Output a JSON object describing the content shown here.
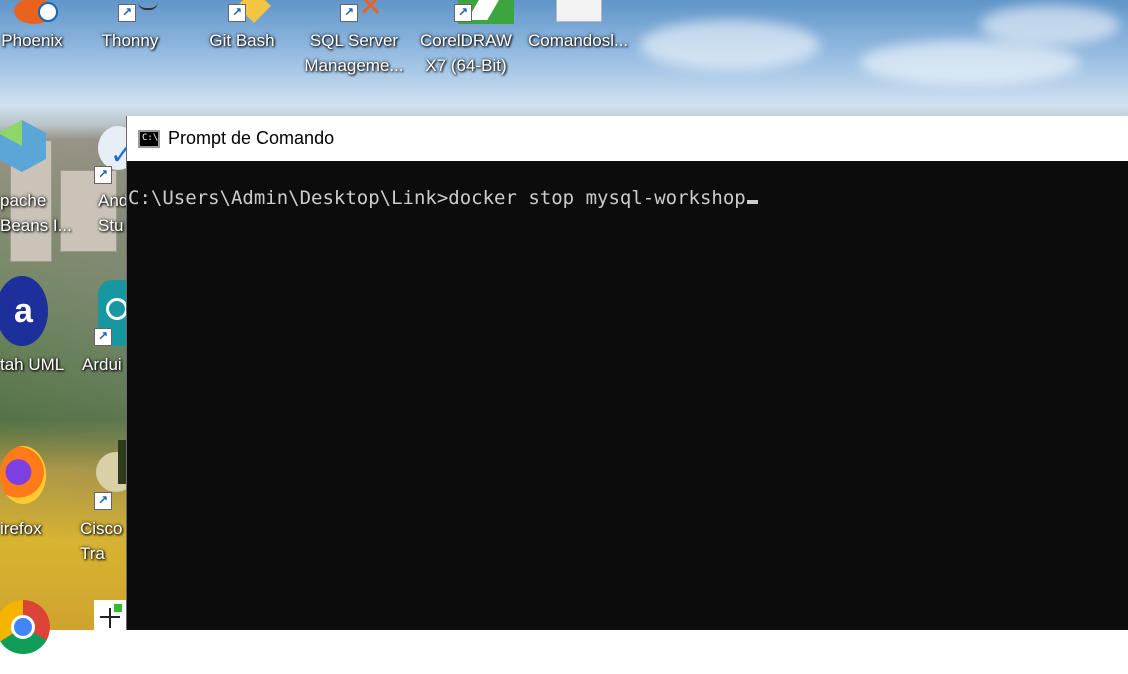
{
  "desktop": {
    "icons": [
      {
        "label": "Phoenix",
        "icon": "phoenix-icon"
      },
      {
        "label": "Thonny",
        "icon": "thonny-icon"
      },
      {
        "label": "Git Bash",
        "icon": "git-bash-icon"
      },
      {
        "label": "SQL Server\nManageme...",
        "icon": "sql-server-icon"
      },
      {
        "label": "CorelDRAW\nX7 (64-Bit)",
        "icon": "coreldraw-icon"
      },
      {
        "label": "Comandosl...",
        "icon": "text-file-icon"
      },
      {
        "label": "pache\nBeans I...",
        "icon": "netbeans-icon"
      },
      {
        "label": "And\nStu",
        "icon": "android-studio-icon"
      },
      {
        "label": "tah UML",
        "icon": "astah-icon"
      },
      {
        "label": "Ardui",
        "icon": "arduino-icon"
      },
      {
        "label": "irefox",
        "icon": "firefox-icon"
      },
      {
        "label": "Cisco\nTra",
        "icon": "cisco-icon"
      },
      {
        "label": "",
        "icon": "chrome-icon"
      },
      {
        "label": "",
        "icon": "network-icon"
      }
    ]
  },
  "cmd": {
    "title": "Prompt de Comando",
    "icon_text": "C:\\",
    "prompt": "C:\\Users\\Admin\\Desktop\\Link>",
    "command": "docker stop mysql-workshop"
  },
  "colors": {
    "console_bg": "#0c0c0c",
    "console_fg": "#cccccc",
    "titlebar_bg": "#ffffff"
  }
}
